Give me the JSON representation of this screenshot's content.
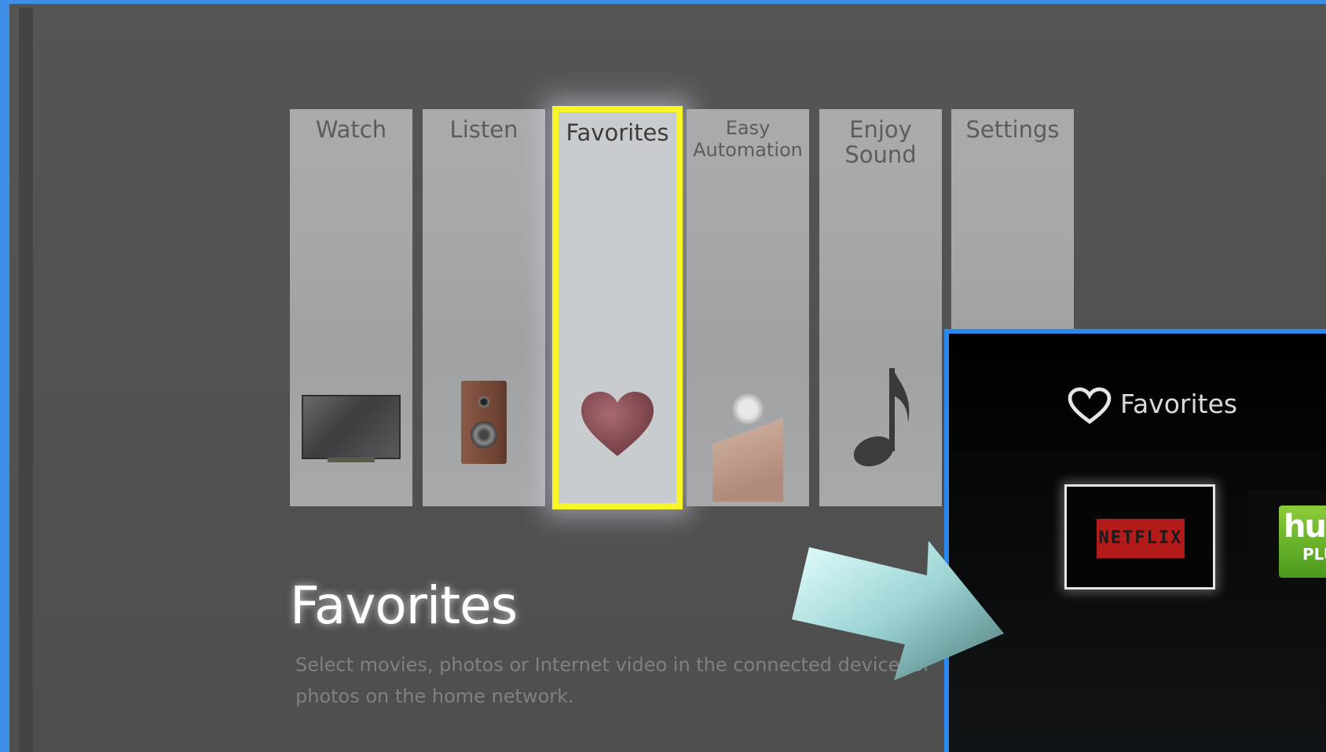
{
  "menu": {
    "items": [
      {
        "label": "Watch",
        "icon": "tv-icon"
      },
      {
        "label": "Listen",
        "icon": "speaker-icon"
      },
      {
        "label": "Favorites",
        "icon": "heart-icon",
        "selected": true
      },
      {
        "label": "Easy\nAutomation",
        "icon": "button-press-icon"
      },
      {
        "label": "Enjoy\nSound",
        "icon": "music-note-icon"
      },
      {
        "label": "Settings",
        "icon": ""
      }
    ]
  },
  "detail": {
    "title": "Favorites",
    "description": "Select movies, photos or Internet video in the connected device, or photos on the home network."
  },
  "panel": {
    "title": "Favorites",
    "tiles": [
      {
        "name": "NETFLIX"
      },
      {
        "name": "hulu",
        "sub": "PLUS"
      }
    ]
  },
  "colors": {
    "highlight": "#f6f629",
    "frame_border": "#3d8fe8",
    "netflix_red": "#b31b1b",
    "hulu_green": "#6ab62c"
  }
}
